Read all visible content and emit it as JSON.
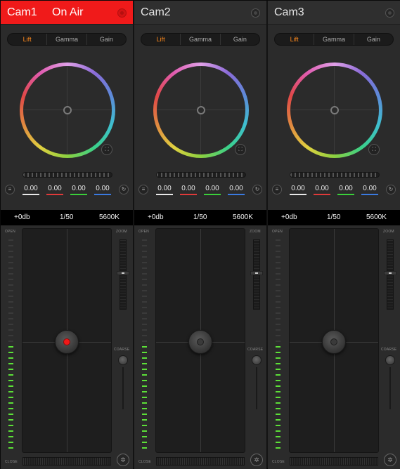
{
  "cameras": [
    {
      "name": "Cam1",
      "on_air": true,
      "on_air_label": "On Air",
      "tabs": [
        "Lift",
        "Gamma",
        "Gain"
      ],
      "active_tab": "Lift",
      "rgb": {
        "y": "0.00",
        "r": "0.00",
        "g": "0.00",
        "b": "0.00"
      },
      "status": {
        "gain": "+0db",
        "shutter": "1/50",
        "white_balance": "5600K"
      },
      "labels": {
        "open": "OPEN",
        "close": "CLOSE",
        "zoom": "ZOOM",
        "tele": "T",
        "wide": "W",
        "coarse": "COARSE"
      },
      "iris_level_fraction": 0.5,
      "joystick_dot_color": "#f01818"
    },
    {
      "name": "Cam2",
      "on_air": false,
      "on_air_label": "",
      "tabs": [
        "Lift",
        "Gamma",
        "Gain"
      ],
      "active_tab": "Lift",
      "rgb": {
        "y": "0.00",
        "r": "0.00",
        "g": "0.00",
        "b": "0.00"
      },
      "status": {
        "gain": "+0db",
        "shutter": "1/50",
        "white_balance": "5600K"
      },
      "labels": {
        "open": "OPEN",
        "close": "CLOSE",
        "zoom": "ZOOM",
        "tele": "T",
        "wide": "W",
        "coarse": "COARSE"
      },
      "iris_level_fraction": 0.5,
      "joystick_dot_color": "#3a3a3a"
    },
    {
      "name": "Cam3",
      "on_air": false,
      "on_air_label": "",
      "tabs": [
        "Lift",
        "Gamma",
        "Gain"
      ],
      "active_tab": "Lift",
      "rgb": {
        "y": "0.00",
        "r": "0.00",
        "g": "0.00",
        "b": "0.00"
      },
      "status": {
        "gain": "+0db",
        "shutter": "1/50",
        "white_balance": "5600K"
      },
      "labels": {
        "open": "OPEN",
        "close": "CLOSE",
        "zoom": "ZOOM",
        "tele": "T",
        "wide": "W",
        "coarse": "COARSE"
      },
      "iris_level_fraction": 0.5,
      "joystick_dot_color": "#3a3a3a"
    }
  ],
  "colors": {
    "on_air_red": "#f01a1a",
    "active_tab": "#ff8a1d",
    "iris_meter_on": "#5ce038",
    "line_y": "#e8e8e8",
    "line_r": "#e03a3a",
    "line_g": "#3ad03a",
    "line_b": "#3a7ae0"
  },
  "icons": {
    "header_button": "record-dot-icon",
    "expand": "expand-icon",
    "menu": "menu-icon",
    "reset": "reset-icon",
    "auto_iris": "auto-iris-icon"
  }
}
